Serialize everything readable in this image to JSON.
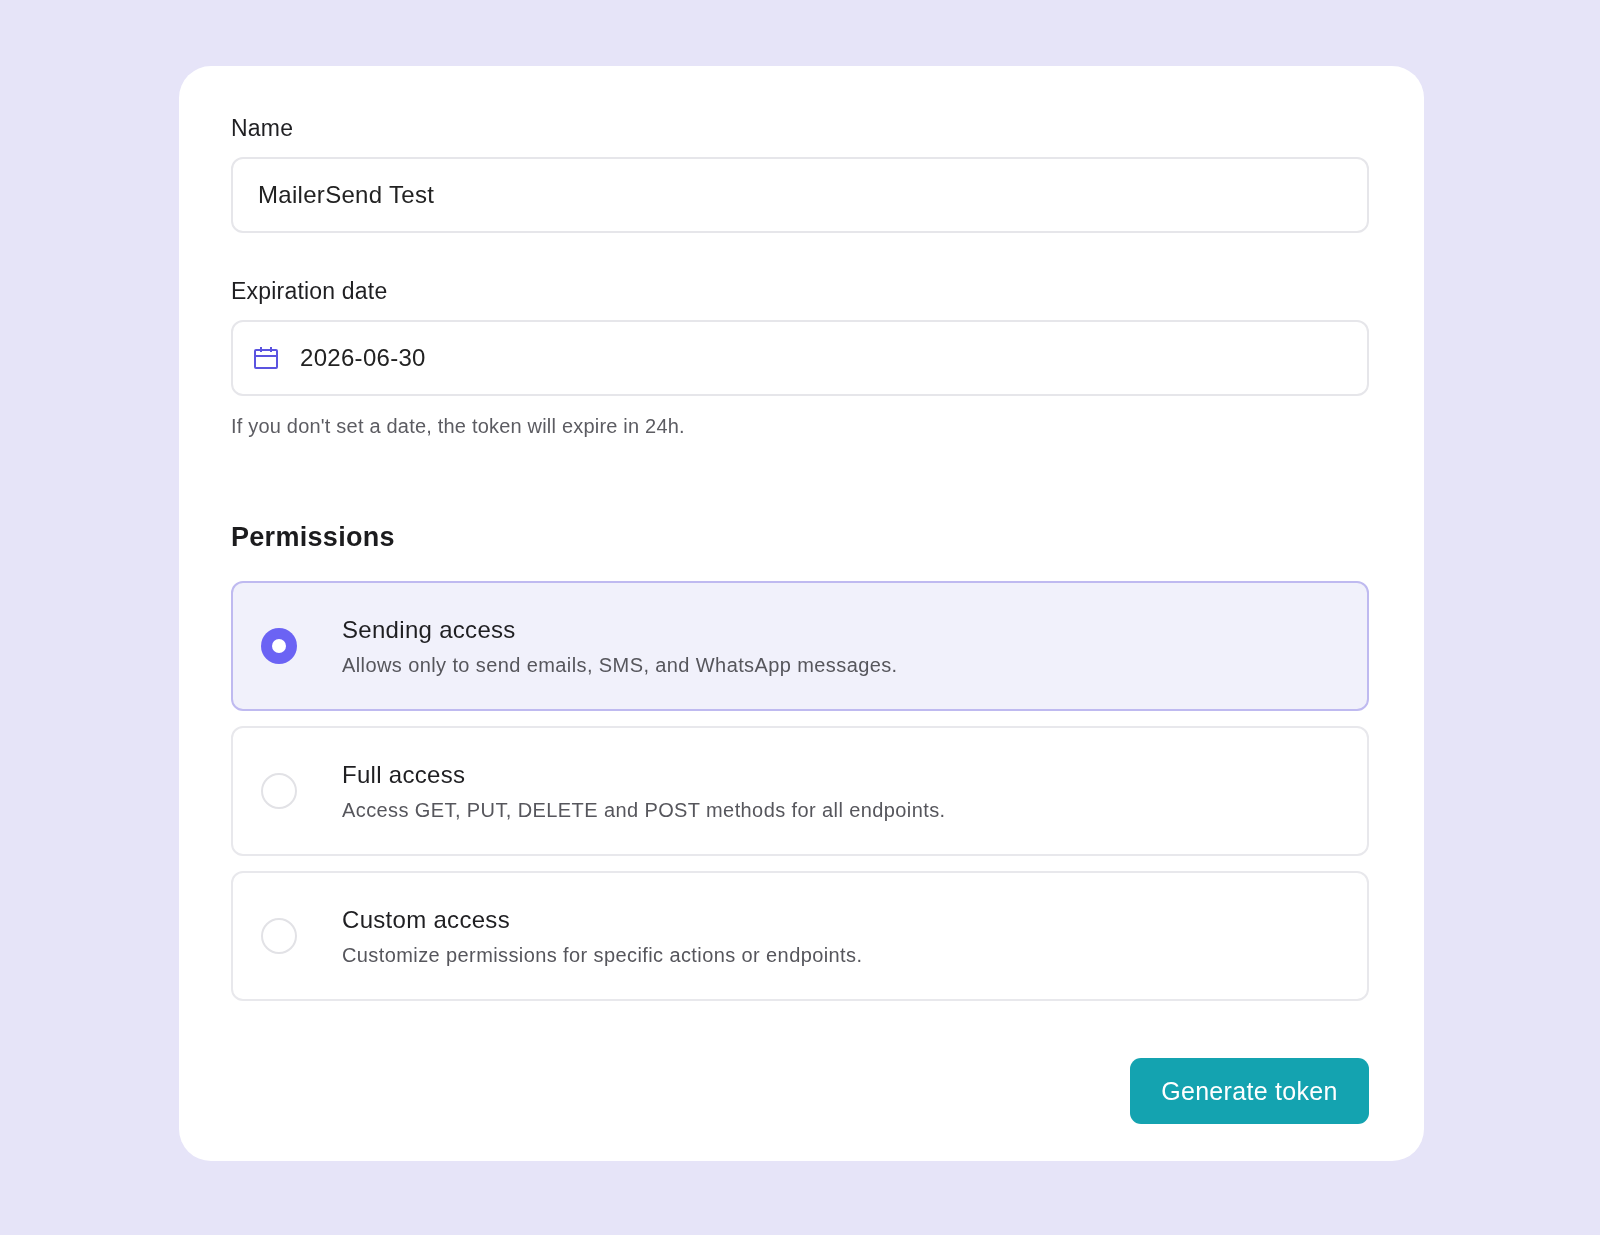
{
  "form": {
    "name_field": {
      "label": "Name",
      "value": "MailerSend Test"
    },
    "expiration_field": {
      "label": "Expiration date",
      "value": "2026-06-30",
      "hint": "If you don't set a date, the token will expire in 24h."
    }
  },
  "permissions": {
    "title": "Permissions",
    "options": [
      {
        "title": "Sending access",
        "description": "Allows only to send emails, SMS, and WhatsApp messages.",
        "selected": true
      },
      {
        "title": "Full access",
        "description": "Access GET, PUT, DELETE and POST methods for all endpoints.",
        "selected": false
      },
      {
        "title": "Custom access",
        "description": "Customize permissions for specific actions or endpoints.",
        "selected": false
      }
    ]
  },
  "submit_button": {
    "label": "Generate token"
  }
}
